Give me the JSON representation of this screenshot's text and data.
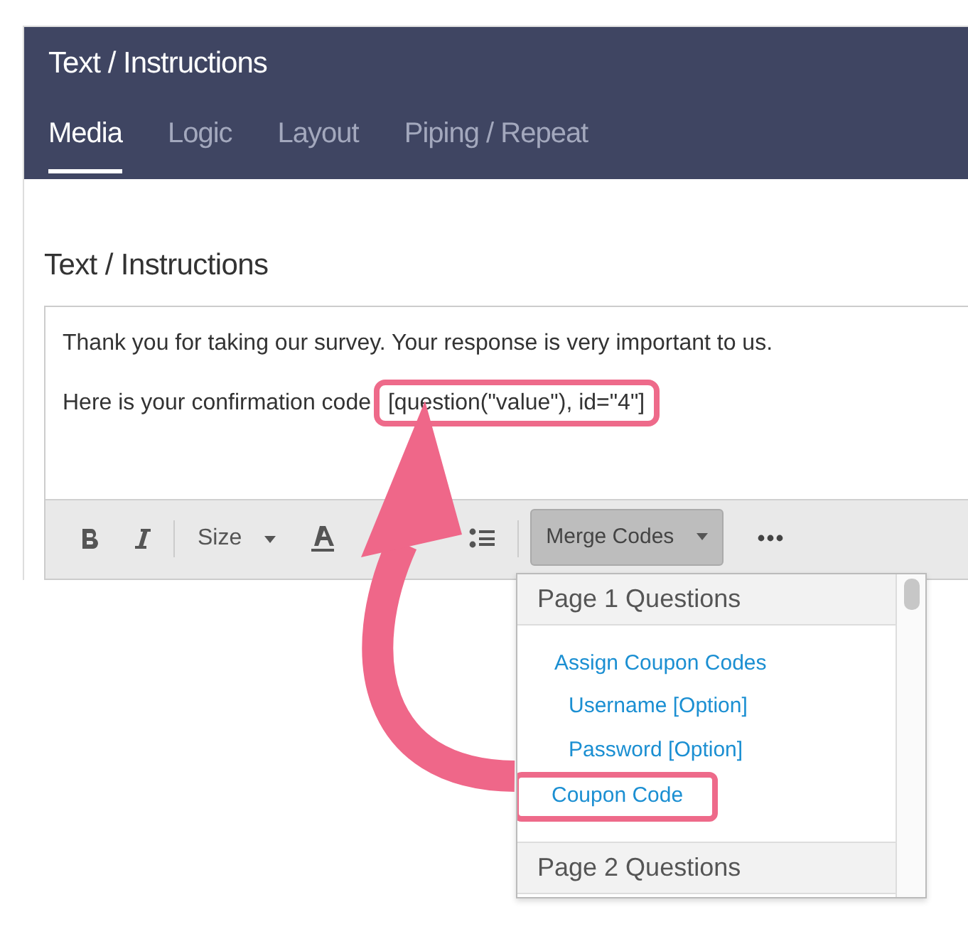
{
  "header": {
    "title": "Text / Instructions"
  },
  "tabs": [
    {
      "label": "Media",
      "selected": true
    },
    {
      "label": "Logic",
      "selected": false
    },
    {
      "label": "Layout",
      "selected": false
    },
    {
      "label": "Piping / Repeat",
      "selected": false
    }
  ],
  "section_title": "Text / Instructions",
  "editor": {
    "paragraphs": [
      {
        "text": "Thank you for taking our survey. Your response is very important to us."
      },
      {
        "text": "Here is your confirmation code",
        "merge_code": "[question(\"value\"), id=\"4\"]"
      }
    ]
  },
  "toolbar": {
    "size_label": "Size",
    "merge_button": {
      "label": "Merge Codes",
      "pressed": true
    }
  },
  "dropdown": {
    "groups": [
      {
        "heading": "Page 1 Questions",
        "items": [
          {
            "label": "Assign Coupon Codes",
            "highlighted": false,
            "children": [
              {
                "label": "Username [Option]"
              },
              {
                "label": "Password [Option]"
              }
            ]
          },
          {
            "label": "Coupon Code",
            "highlighted": true
          }
        ]
      },
      {
        "heading": "Page 2 Questions"
      }
    ]
  }
}
